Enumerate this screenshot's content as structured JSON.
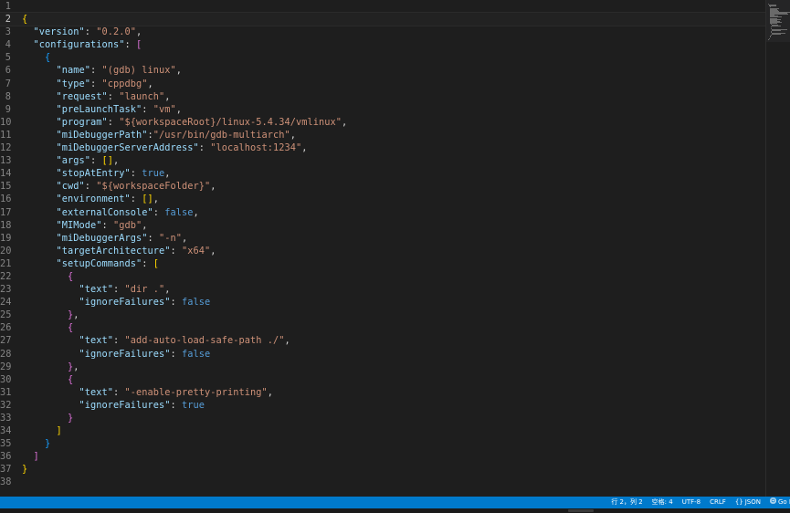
{
  "editor": {
    "language": "JSON",
    "lines": [
      {
        "n": "1",
        "tokens": []
      },
      {
        "n": "2",
        "current": true,
        "tokens": [
          {
            "t": "{",
            "c": "br1"
          }
        ]
      },
      {
        "n": "3",
        "tokens": [
          {
            "t": "  "
          },
          {
            "t": "\"version\"",
            "c": "k"
          },
          {
            "t": ": ",
            "c": "p"
          },
          {
            "t": "\"0.2.0\"",
            "c": "s"
          },
          {
            "t": ",",
            "c": "p"
          }
        ]
      },
      {
        "n": "4",
        "tokens": [
          {
            "t": "  "
          },
          {
            "t": "\"configurations\"",
            "c": "k"
          },
          {
            "t": ": ",
            "c": "p"
          },
          {
            "t": "[",
            "c": "br2"
          }
        ]
      },
      {
        "n": "5",
        "tokens": [
          {
            "t": "    "
          },
          {
            "t": "{",
            "c": "br3"
          }
        ]
      },
      {
        "n": "6",
        "tokens": [
          {
            "t": "      "
          },
          {
            "t": "\"name\"",
            "c": "k"
          },
          {
            "t": ": ",
            "c": "p"
          },
          {
            "t": "\"(gdb) linux\"",
            "c": "s"
          },
          {
            "t": ",",
            "c": "p"
          }
        ]
      },
      {
        "n": "7",
        "tokens": [
          {
            "t": "      "
          },
          {
            "t": "\"type\"",
            "c": "k"
          },
          {
            "t": ": ",
            "c": "p"
          },
          {
            "t": "\"cppdbg\"",
            "c": "s"
          },
          {
            "t": ",",
            "c": "p"
          }
        ]
      },
      {
        "n": "8",
        "tokens": [
          {
            "t": "      "
          },
          {
            "t": "\"request\"",
            "c": "k"
          },
          {
            "t": ": ",
            "c": "p"
          },
          {
            "t": "\"launch\"",
            "c": "s"
          },
          {
            "t": ",",
            "c": "p"
          }
        ]
      },
      {
        "n": "9",
        "tokens": [
          {
            "t": "      "
          },
          {
            "t": "\"preLaunchTask\"",
            "c": "k"
          },
          {
            "t": ": ",
            "c": "p"
          },
          {
            "t": "\"vm\"",
            "c": "s"
          },
          {
            "t": ",",
            "c": "p"
          }
        ]
      },
      {
        "n": "10",
        "tokens": [
          {
            "t": "      "
          },
          {
            "t": "\"program\"",
            "c": "k"
          },
          {
            "t": ": ",
            "c": "p"
          },
          {
            "t": "\"${workspaceRoot}/linux-5.4.34/vmlinux\"",
            "c": "s"
          },
          {
            "t": ",",
            "c": "p"
          }
        ]
      },
      {
        "n": "11",
        "tokens": [
          {
            "t": "      "
          },
          {
            "t": "\"miDebuggerPath\"",
            "c": "k"
          },
          {
            "t": ":",
            "c": "p"
          },
          {
            "t": "\"/usr/bin/gdb-multiarch\"",
            "c": "s"
          },
          {
            "t": ",",
            "c": "p"
          }
        ]
      },
      {
        "n": "12",
        "tokens": [
          {
            "t": "      "
          },
          {
            "t": "\"miDebuggerServerAddress\"",
            "c": "k"
          },
          {
            "t": ": ",
            "c": "p"
          },
          {
            "t": "\"localhost:1234\"",
            "c": "s"
          },
          {
            "t": ",",
            "c": "p"
          }
        ]
      },
      {
        "n": "13",
        "tokens": [
          {
            "t": "      "
          },
          {
            "t": "\"args\"",
            "c": "k"
          },
          {
            "t": ": ",
            "c": "p"
          },
          {
            "t": "[]",
            "c": "br1"
          },
          {
            "t": ",",
            "c": "p"
          }
        ]
      },
      {
        "n": "14",
        "tokens": [
          {
            "t": "      "
          },
          {
            "t": "\"stopAtEntry\"",
            "c": "k"
          },
          {
            "t": ": ",
            "c": "p"
          },
          {
            "t": "true",
            "c": "b"
          },
          {
            "t": ",",
            "c": "p"
          }
        ]
      },
      {
        "n": "15",
        "tokens": [
          {
            "t": "      "
          },
          {
            "t": "\"cwd\"",
            "c": "k"
          },
          {
            "t": ": ",
            "c": "p"
          },
          {
            "t": "\"${workspaceFolder}\"",
            "c": "s"
          },
          {
            "t": ",",
            "c": "p"
          }
        ]
      },
      {
        "n": "16",
        "tokens": [
          {
            "t": "      "
          },
          {
            "t": "\"environment\"",
            "c": "k"
          },
          {
            "t": ": ",
            "c": "p"
          },
          {
            "t": "[]",
            "c": "br1"
          },
          {
            "t": ",",
            "c": "p"
          }
        ]
      },
      {
        "n": "17",
        "tokens": [
          {
            "t": "      "
          },
          {
            "t": "\"externalConsole\"",
            "c": "k"
          },
          {
            "t": ": ",
            "c": "p"
          },
          {
            "t": "false",
            "c": "b"
          },
          {
            "t": ",",
            "c": "p"
          }
        ]
      },
      {
        "n": "18",
        "tokens": [
          {
            "t": "      "
          },
          {
            "t": "\"MIMode\"",
            "c": "k"
          },
          {
            "t": ": ",
            "c": "p"
          },
          {
            "t": "\"gdb\"",
            "c": "s"
          },
          {
            "t": ",",
            "c": "p"
          }
        ]
      },
      {
        "n": "19",
        "tokens": [
          {
            "t": "      "
          },
          {
            "t": "\"miDebuggerArgs\"",
            "c": "k"
          },
          {
            "t": ": ",
            "c": "p"
          },
          {
            "t": "\"-n\"",
            "c": "s"
          },
          {
            "t": ",",
            "c": "p"
          }
        ]
      },
      {
        "n": "20",
        "tokens": [
          {
            "t": "      "
          },
          {
            "t": "\"targetArchitecture\"",
            "c": "k"
          },
          {
            "t": ": ",
            "c": "p"
          },
          {
            "t": "\"x64\"",
            "c": "s"
          },
          {
            "t": ",",
            "c": "p"
          }
        ]
      },
      {
        "n": "21",
        "tokens": [
          {
            "t": "      "
          },
          {
            "t": "\"setupCommands\"",
            "c": "k"
          },
          {
            "t": ": ",
            "c": "p"
          },
          {
            "t": "[",
            "c": "br1"
          }
        ]
      },
      {
        "n": "22",
        "tokens": [
          {
            "t": "        "
          },
          {
            "t": "{",
            "c": "br2"
          }
        ]
      },
      {
        "n": "23",
        "tokens": [
          {
            "t": "          "
          },
          {
            "t": "\"text\"",
            "c": "k"
          },
          {
            "t": ": ",
            "c": "p"
          },
          {
            "t": "\"dir .\"",
            "c": "s"
          },
          {
            "t": ",",
            "c": "p"
          }
        ]
      },
      {
        "n": "24",
        "tokens": [
          {
            "t": "          "
          },
          {
            "t": "\"ignoreFailures\"",
            "c": "k"
          },
          {
            "t": ": ",
            "c": "p"
          },
          {
            "t": "false",
            "c": "b"
          }
        ]
      },
      {
        "n": "25",
        "tokens": [
          {
            "t": "        "
          },
          {
            "t": "}",
            "c": "br2"
          },
          {
            "t": ",",
            "c": "p"
          }
        ]
      },
      {
        "n": "26",
        "tokens": [
          {
            "t": "        "
          },
          {
            "t": "{",
            "c": "br2"
          }
        ]
      },
      {
        "n": "27",
        "tokens": [
          {
            "t": "          "
          },
          {
            "t": "\"text\"",
            "c": "k"
          },
          {
            "t": ": ",
            "c": "p"
          },
          {
            "t": "\"add-auto-load-safe-path ./\"",
            "c": "s"
          },
          {
            "t": ",",
            "c": "p"
          }
        ]
      },
      {
        "n": "28",
        "tokens": [
          {
            "t": "          "
          },
          {
            "t": "\"ignoreFailures\"",
            "c": "k"
          },
          {
            "t": ": ",
            "c": "p"
          },
          {
            "t": "false",
            "c": "b"
          }
        ]
      },
      {
        "n": "29",
        "tokens": [
          {
            "t": "        "
          },
          {
            "t": "}",
            "c": "br2"
          },
          {
            "t": ",",
            "c": "p"
          }
        ]
      },
      {
        "n": "30",
        "tokens": [
          {
            "t": "        "
          },
          {
            "t": "{",
            "c": "br2"
          }
        ]
      },
      {
        "n": "31",
        "tokens": [
          {
            "t": "          "
          },
          {
            "t": "\"text\"",
            "c": "k"
          },
          {
            "t": ": ",
            "c": "p"
          },
          {
            "t": "\"-enable-pretty-printing\"",
            "c": "s"
          },
          {
            "t": ",",
            "c": "p"
          }
        ]
      },
      {
        "n": "32",
        "tokens": [
          {
            "t": "          "
          },
          {
            "t": "\"ignoreFailures\"",
            "c": "k"
          },
          {
            "t": ": ",
            "c": "p"
          },
          {
            "t": "true",
            "c": "b"
          }
        ]
      },
      {
        "n": "33",
        "tokens": [
          {
            "t": "        "
          },
          {
            "t": "}",
            "c": "br2"
          }
        ]
      },
      {
        "n": "34",
        "tokens": [
          {
            "t": "      "
          },
          {
            "t": "]",
            "c": "br1"
          }
        ]
      },
      {
        "n": "35",
        "tokens": [
          {
            "t": "    "
          },
          {
            "t": "}",
            "c": "br3"
          }
        ]
      },
      {
        "n": "36",
        "tokens": [
          {
            "t": "  "
          },
          {
            "t": "]",
            "c": "br2"
          }
        ]
      },
      {
        "n": "37",
        "tokens": [
          {
            "t": "}",
            "c": "br1"
          }
        ]
      },
      {
        "n": "38",
        "tokens": []
      }
    ]
  },
  "statusbar": {
    "cursor_position": "行 2，列 2",
    "indentation": "空格: 4",
    "encoding": "UTF-8",
    "line_ending": "CRLF",
    "language_icon": "{}",
    "language": "JSON",
    "go_live_icon": "broadcast-icon",
    "go_live": "Go Live"
  },
  "colors": {
    "statusbar_bg": "#007acc",
    "editor_bg": "#1e1e1e",
    "key": "#9cdcfe",
    "string": "#ce9178",
    "boolean": "#569cd6"
  }
}
